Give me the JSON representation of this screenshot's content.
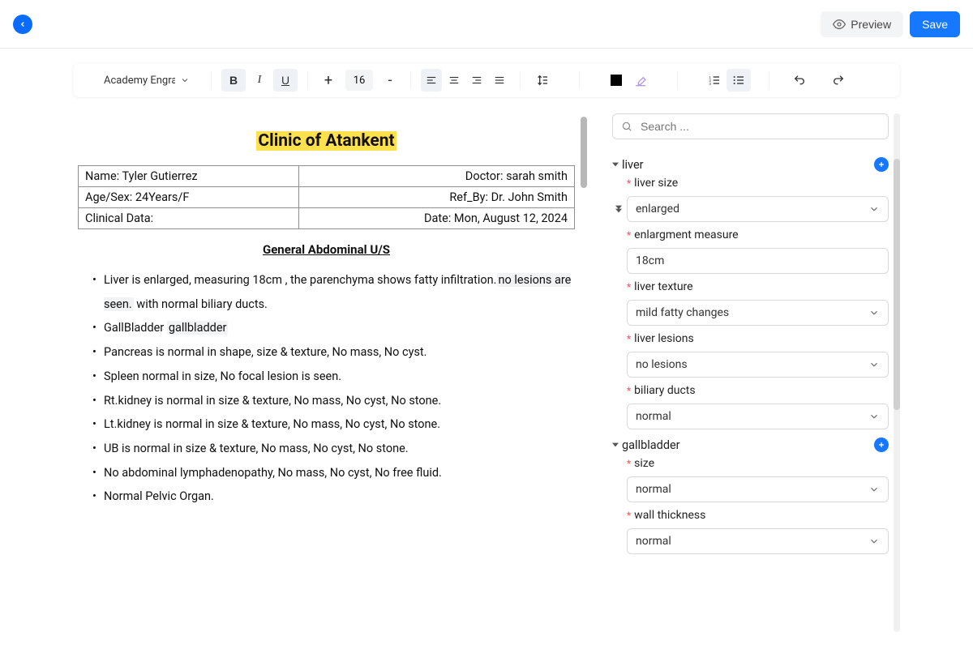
{
  "header": {
    "preview_label": "Preview",
    "save_label": "Save"
  },
  "toolbar": {
    "font_name": "Academy Engrav",
    "font_size": "16",
    "bold": "B",
    "italic": "I",
    "underline": "U"
  },
  "document": {
    "clinic_title": "Clinic of Atankent",
    "info": {
      "name_label": "Name: Tyler Gutierrez",
      "doctor_label": "Doctor: sarah smith",
      "age_label": "Age/Sex: 24Years/F",
      "ref_label": "Ref_By: Dr. John  Smith",
      "clinical_label": "Clinical Data:",
      "date_label": "Date: Mon, August 12, 2024"
    },
    "subheading": "General Abdominal U/S",
    "bullets": [
      {
        "pre": "Liver is enlarged, measuring 18cm , the parenchyma shows fatty infiltration.",
        "ph": "no lesions are seen.",
        "post": " with normal biliary ducts."
      },
      {
        "pre": "GallBladder ",
        "ph": "gallbladder",
        "post": ""
      },
      {
        "pre": "Pancreas is normal in shape, size & texture, No mass, No cyst.",
        "ph": "",
        "post": ""
      },
      {
        "pre": "Spleen normal in size, No focal lesion is seen.",
        "ph": "",
        "post": ""
      },
      {
        "pre": "Rt.kidney  is normal in size & texture, No mass, No cyst, No stone.",
        "ph": "",
        "post": ""
      },
      {
        "pre": "Lt.kidney  is normal in size & texture, No mass, No cyst, No stone.",
        "ph": "",
        "post": ""
      },
      {
        "pre": "UB is normal in size & texture, No mass, No cyst, No stone.",
        "ph": "",
        "post": ""
      },
      {
        "pre": "No abdominal lymphadenopathy, No mass, No cyst, No free fluid.",
        "ph": "",
        "post": ""
      },
      {
        "pre": "Normal Pelvic Organ.",
        "ph": "",
        "post": ""
      }
    ]
  },
  "sidebar": {
    "search_placeholder": "Search ...",
    "sections": [
      {
        "title": "liver",
        "fields": [
          {
            "label": "liver size",
            "type": "select",
            "value": "enlarged"
          },
          {
            "label": "enlargment measure",
            "type": "text",
            "value": "18cm",
            "caret": true
          },
          {
            "label": "liver texture",
            "type": "select",
            "value": "mild fatty changes"
          },
          {
            "label": "liver lesions",
            "type": "select",
            "value": "no lesions"
          },
          {
            "label": "biliary ducts",
            "type": "select",
            "value": "normal"
          }
        ]
      },
      {
        "title": "gallbladder",
        "fields": [
          {
            "label": "size",
            "type": "select",
            "value": "normal"
          },
          {
            "label": "wall thickness",
            "type": "select",
            "value": "normal"
          }
        ]
      }
    ]
  }
}
